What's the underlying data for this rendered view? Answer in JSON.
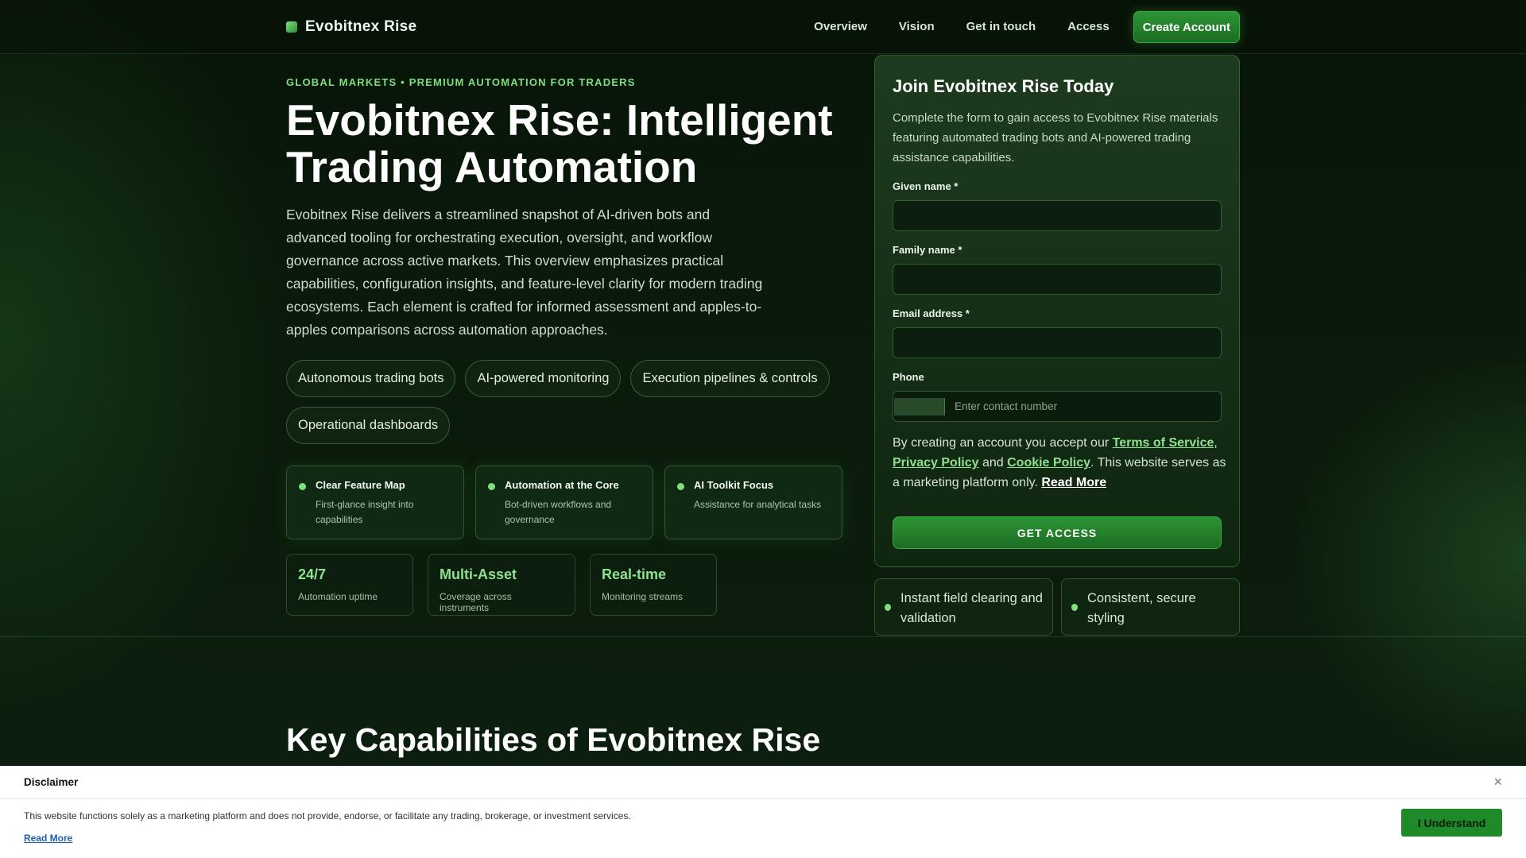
{
  "brand": {
    "name": "Evobitnex Rise",
    "icon": "brand-square-icon"
  },
  "nav": {
    "links": [
      "Overview",
      "Vision",
      "Get in touch",
      "Access"
    ],
    "cta": "Create Account"
  },
  "hero": {
    "eyebrow": "GLOBAL MARKETS • PREMIUM AUTOMATION FOR TRADERS",
    "title": "Evobitnex Rise: Intelligent Trading Automation",
    "description": "Evobitnex Rise delivers a streamlined snapshot of AI-driven bots and advanced tooling for orchestrating execution, oversight, and workflow governance across active markets. This overview emphasizes practical capabilities, configuration insights, and feature-level clarity for modern trading ecosystems. Each element is crafted for informed assessment and apples-to-apples comparisons across automation approaches.",
    "chips": [
      "Autonomous trading bots",
      "AI-powered monitoring",
      "Execution pipelines & controls",
      "Operational dashboards"
    ],
    "features": [
      {
        "title": "Clear Feature Map",
        "subtitle": "First-glance insight into capabilities"
      },
      {
        "title": "Automation at the Core",
        "subtitle": "Bot-driven workflows and governance"
      },
      {
        "title": "AI Toolkit Focus",
        "subtitle": "Assistance for analytical tasks"
      }
    ],
    "stats": [
      {
        "value": "24/7",
        "label": "Automation uptime"
      },
      {
        "value": "Multi-Asset",
        "label": "Coverage across instruments"
      },
      {
        "value": "Real-time",
        "label": "Monitoring streams"
      }
    ]
  },
  "form": {
    "title": "Join Evobitnex Rise Today",
    "description": "Complete the form to gain access to Evobitnex Rise materials featuring automated trading bots and AI-powered trading assistance capabilities.",
    "given_name_label": "Given name *",
    "family_name_label": "Family name *",
    "email_label": "Email address *",
    "phone_label": "Phone",
    "phone_placeholder": "Enter contact number",
    "given_name_value": "",
    "family_name_value": "",
    "email_value": "",
    "terms_prefix": "By creating an account you accept our ",
    "terms_link": "Terms of Service",
    "terms_comma": ",",
    "privacy_link": "Privacy Policy",
    "and_text": " and ",
    "cookie_link": "Cookie Policy",
    "terms_suffix": ". This website serves as a marketing platform only. ",
    "read_more": "Read More",
    "submit": "GET ACCESS"
  },
  "mini_cards": [
    "Instant field clearing and validation",
    "Consistent, secure styling"
  ],
  "section": {
    "title": "Key Capabilities of Evobitnex Rise"
  },
  "disclaimer": {
    "title": "Disclaimer",
    "close": "×",
    "text": "This website functions solely as a marketing platform and does not provide, endorse, or facilitate any trading, brokerage, or investment services.",
    "read_more": "Read More",
    "button": "I Understand"
  },
  "colors": {
    "accent": "#7fe07f",
    "button": "#2c9435",
    "background": "#0a1a0c"
  }
}
